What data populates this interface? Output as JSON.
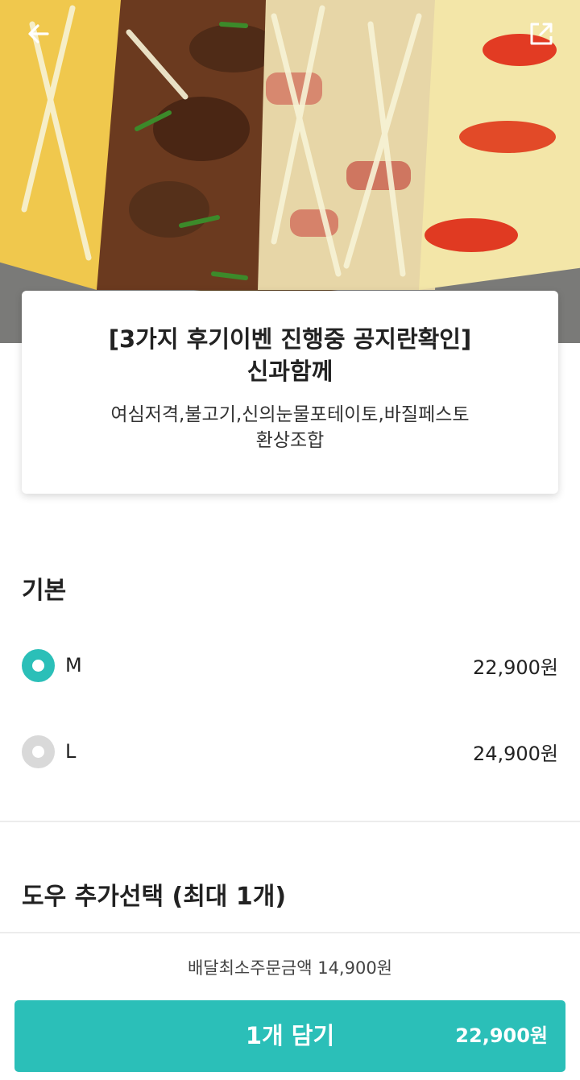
{
  "menu": {
    "title_line1": "[3가지 후기이벤 진행중 공지란확인]",
    "title_line2": "신과함께",
    "desc_line1": "여심저격,불고기,신의눈물포테이토,바질페스토",
    "desc_line2": "환상조합"
  },
  "option_groups": {
    "basic": {
      "title": "기본",
      "options": [
        {
          "label": "M",
          "price": "22,900원",
          "selected": true
        },
        {
          "label": "L",
          "price": "24,900원",
          "selected": false
        }
      ]
    },
    "dough": {
      "title": "도우 추가선택 (최대 1개)"
    }
  },
  "footer": {
    "min_order": "배달최소주문금액 14,900원",
    "cart_label": "1개 담기",
    "cart_total": "22,900원"
  },
  "icons": {
    "back": "arrow-left-icon",
    "share": "share-external-icon"
  },
  "colors": {
    "accent": "#2bbfb8",
    "radio_off": "#d9d9d9"
  }
}
